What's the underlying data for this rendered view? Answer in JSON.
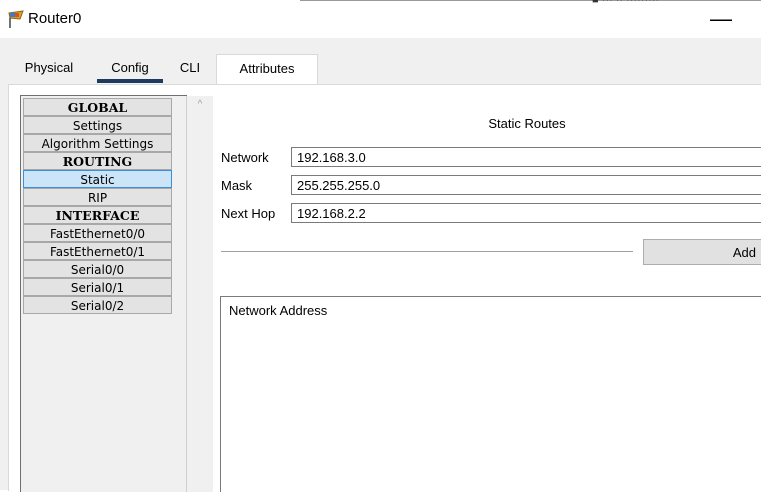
{
  "window": {
    "title": "Router0",
    "minimize_glyph": "—",
    "top_fragment": "■  ···  ·· ·········",
    "icon": "router-app-icon"
  },
  "tabs": [
    {
      "label": "Physical"
    },
    {
      "label": "Config",
      "active": true
    },
    {
      "label": "CLI"
    },
    {
      "label": "Attributes"
    }
  ],
  "sidebar": {
    "items": [
      {
        "label": "GLOBAL",
        "type": "header"
      },
      {
        "label": "Settings"
      },
      {
        "label": "Algorithm Settings"
      },
      {
        "label": "ROUTING",
        "type": "header"
      },
      {
        "label": "Static",
        "selected": true
      },
      {
        "label": "RIP"
      },
      {
        "label": "INTERFACE",
        "type": "header"
      },
      {
        "label": "FastEthernet0/0"
      },
      {
        "label": "FastEthernet0/1"
      },
      {
        "label": "Serial0/0"
      },
      {
        "label": "Serial0/1"
      },
      {
        "label": "Serial0/2"
      }
    ],
    "scroll_up_glyph": "^"
  },
  "static_routes": {
    "title": "Static Routes",
    "network_label": "Network",
    "network_value": "192.168.3.0",
    "mask_label": "Mask",
    "mask_value": "255.255.255.0",
    "next_hop_label": "Next Hop",
    "next_hop_value": "192.168.2.2",
    "add_label": "Add",
    "list_header": "Network Address"
  },
  "colors": {
    "selected_bg": "#cce4f7",
    "selected_border": "#3b8fd9",
    "tab_underline": "#1e3a5f"
  }
}
